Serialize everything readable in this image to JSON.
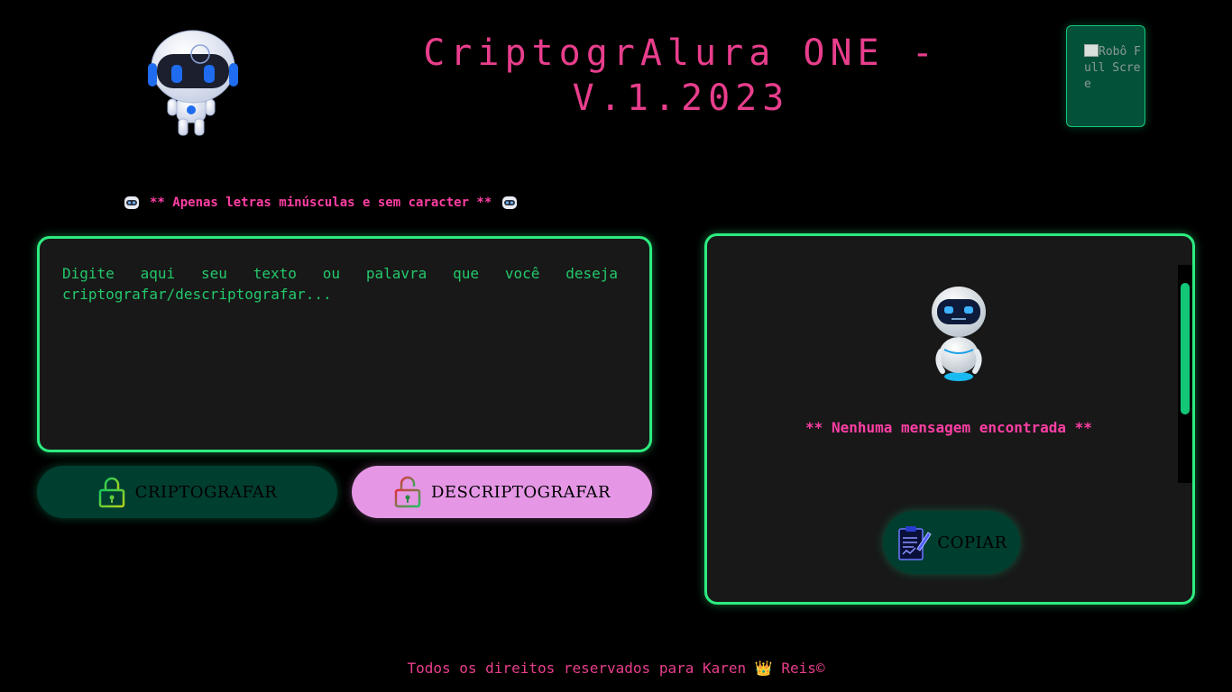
{
  "header": {
    "title": "CriptogrAlura ONE - V.1.2023",
    "fullscreen_button": {
      "alt_text": "Robô Full Scree",
      "icon": "broken-image-icon"
    }
  },
  "warning": {
    "text": "** Apenas letras minúsculas e sem caracter **",
    "icon": "robot-emoji-icon"
  },
  "input": {
    "placeholder": "Digite aqui seu texto ou palavra que você deseja criptografar/descriptografar...",
    "value": ""
  },
  "buttons": {
    "encrypt": {
      "label": "CRIPTOGRAFAR",
      "icon": "lock-icon"
    },
    "decrypt": {
      "label": "DESCRIPTOGRAFAR",
      "icon": "unlock-icon"
    }
  },
  "output": {
    "empty_message": "** Nenhuma mensagem encontrada **",
    "copy_button": {
      "label": "COPIAR",
      "icon": "clipboard-icon"
    }
  },
  "footer": {
    "text_before": "Todos os direitos reservados para Karen",
    "emoji": "👑",
    "text_after": "Reis©"
  },
  "colors": {
    "background": "#000000",
    "accent_pink": "#e83e8c",
    "accent_green": "#2dec80",
    "panel": "#181818",
    "encrypt_button": "#003e30",
    "decrypt_button": "#e597e5"
  }
}
